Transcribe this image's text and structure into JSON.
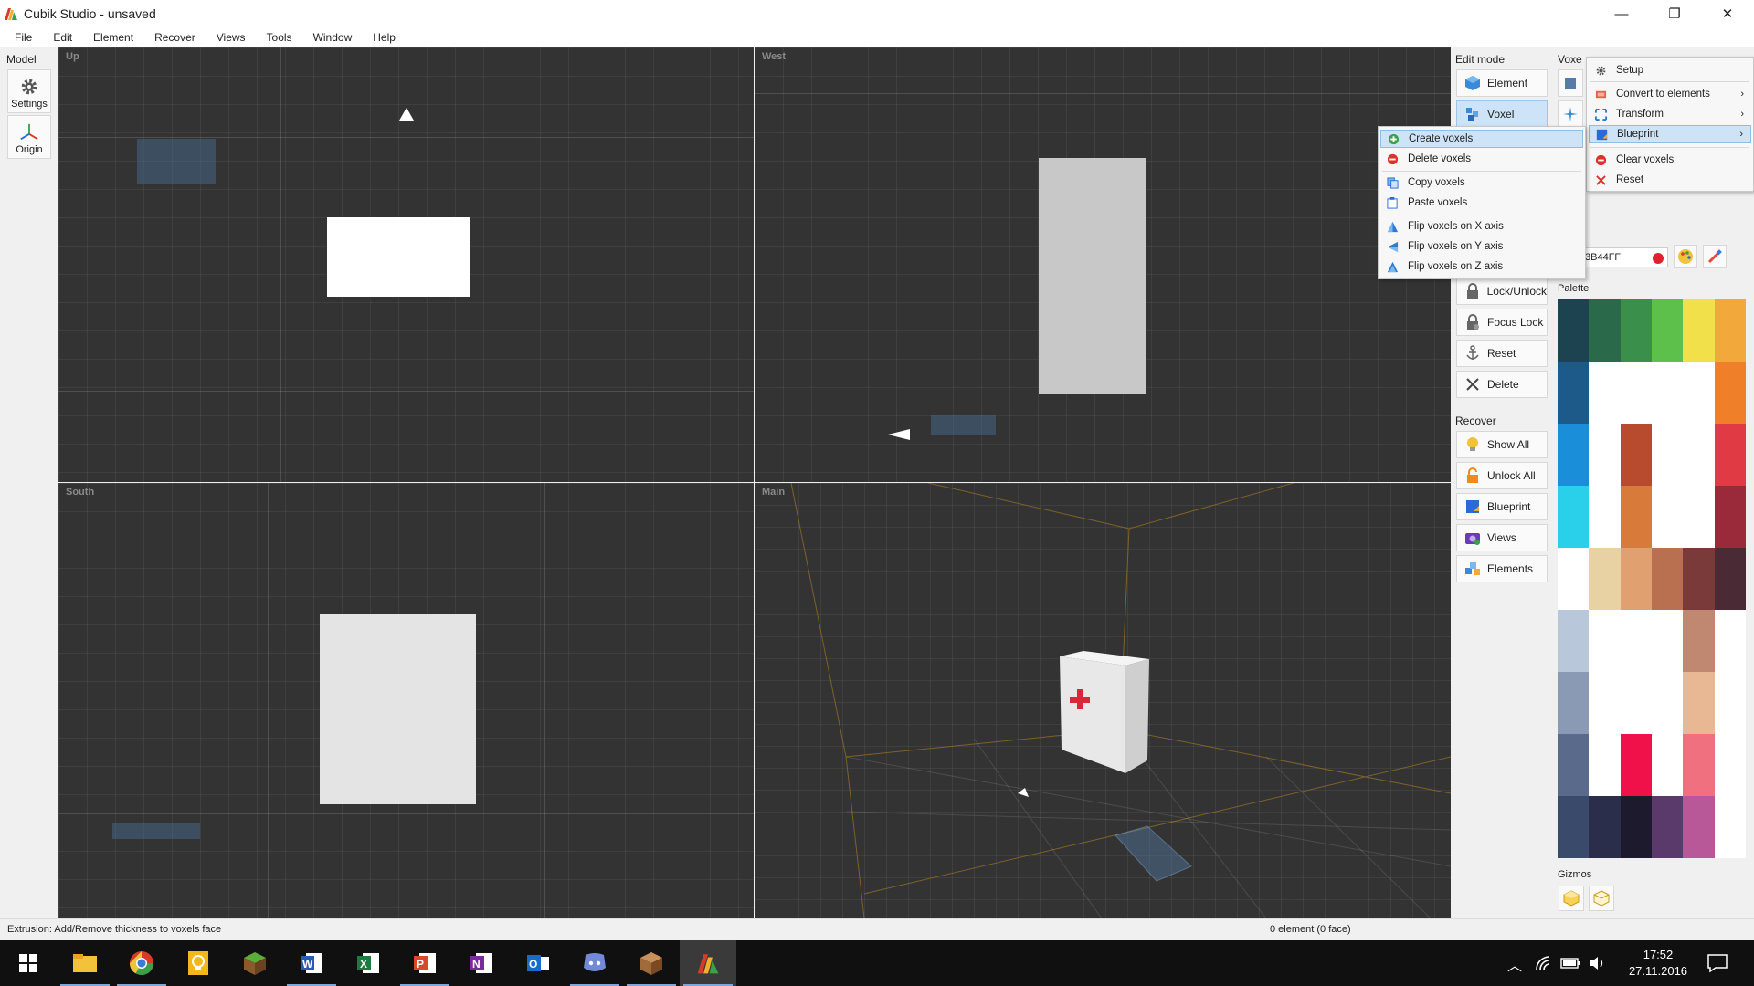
{
  "window": {
    "title": "Cubik Studio - unsaved",
    "minimize_glyph": "—",
    "maximize_glyph": "❐",
    "close_glyph": "✕"
  },
  "menubar": [
    "File",
    "Edit",
    "Element",
    "Recover",
    "Views",
    "Tools",
    "Window",
    "Help"
  ],
  "left_toolbar": {
    "section": "Model",
    "settings_label": "Settings",
    "origin_label": "Origin"
  },
  "viewports": {
    "up": "Up",
    "west": "West",
    "south": "South",
    "main": "Main"
  },
  "statusbar": {
    "hint": "Extrusion: Add/Remove thickness to voxels face",
    "selection": "0 element (0 face)"
  },
  "right_panel": {
    "edit_mode_label": "Edit mode",
    "element_label": "Element",
    "voxel_label": "Voxel",
    "voxel_col_label": "Voxe",
    "lock_unlock": "Lock/Unlock",
    "focus_lock": "Focus Lock",
    "reset": "Reset",
    "delete": "Delete",
    "recover_label": "Recover",
    "show_all": "Show All",
    "unlock_all": "Unlock All",
    "blueprint": "Blueprint",
    "views": "Views",
    "elements": "Elements",
    "color_value": "3B44FF",
    "palette_label": "Palette",
    "gizmos_label": "Gizmos"
  },
  "voxel_menu": {
    "items": [
      "Setup",
      "Convert to elements",
      "Transform",
      "Blueprint",
      "Clear voxels",
      "Reset"
    ]
  },
  "voxel_submenu": {
    "items": [
      "Create voxels",
      "Delete voxels",
      "Copy voxels",
      "Paste voxels",
      "Flip voxels on X axis",
      "Flip voxels on Y axis",
      "Flip voxels on Z axis"
    ]
  },
  "palette_colors": {
    "row0": [
      "#1d4350",
      "#2a6a4a",
      "#3a8f4a",
      "#5cc04a",
      "#f2e04a",
      "#f2a83a"
    ],
    "row1": [
      "#1d5a8a",
      "#ffffff",
      "#ffffff",
      "#ffffff",
      "#ffffff",
      "#f07f2a"
    ],
    "row2": [
      "#1a8ed8",
      "#ffffff",
      "#b84a2e",
      "#ffffff",
      "#ffffff",
      "#e03a44"
    ],
    "row3": [
      "#2ad0ea",
      "#ffffff",
      "#d87a3a",
      "#ffffff",
      "#ffffff",
      "#9a2a3a"
    ],
    "row4": [
      "#ffffff",
      "#e8d2a4",
      "#e0a070",
      "#b87050",
      "#7a3a3a",
      "#4a2a34"
    ],
    "row5": [
      "#b8c8da",
      "#ffffff",
      "#ffffff",
      "#ffffff",
      "#c08870",
      "#ffffff"
    ],
    "row6": [
      "#8a9ab4",
      "#ffffff",
      "#ffffff",
      "#ffffff",
      "#e8b894",
      "#ffffff"
    ],
    "row7": [
      "#5a6a8a",
      "#ffffff",
      "#f0104a",
      "#ffffff",
      "#f07080",
      "#ffffff"
    ],
    "row8": [
      "#3a4a6a",
      "#2a2e4a",
      "#1e1a2e",
      "#5a3a6a",
      "#b85898",
      "#ffffff"
    ]
  },
  "taskbar": {
    "time": "17:52",
    "date": "27.11.2016"
  }
}
